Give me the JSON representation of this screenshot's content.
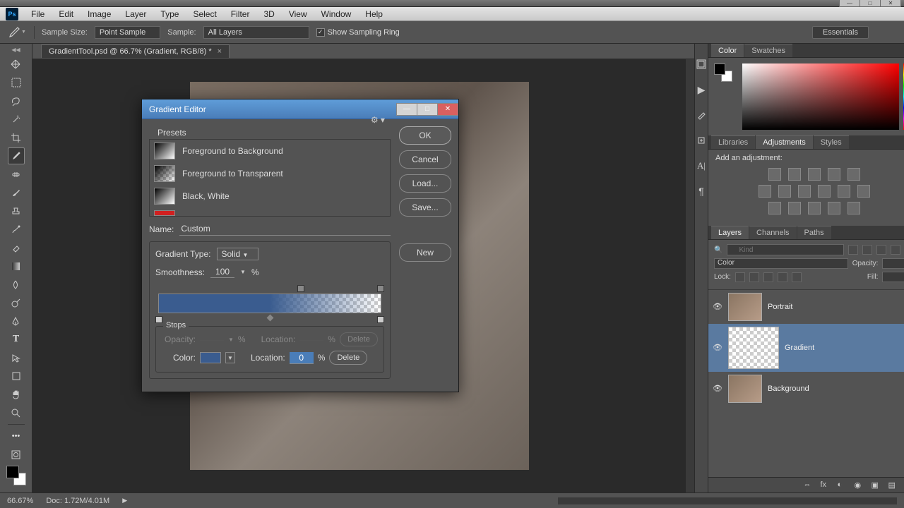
{
  "menu": [
    "File",
    "Edit",
    "Image",
    "Layer",
    "Type",
    "Select",
    "Filter",
    "3D",
    "View",
    "Window",
    "Help"
  ],
  "options_bar": {
    "sample_size_label": "Sample Size:",
    "sample_size_value": "Point Sample",
    "sample_label": "Sample:",
    "sample_value": "All Layers",
    "show_ring": "Show Sampling Ring",
    "workspace": "Essentials"
  },
  "doc_tab": "GradientTool.psd @ 66.7% (Gradient, RGB/8) *",
  "right": {
    "color_tabs": [
      "Color",
      "Swatches"
    ],
    "adj_tabs": [
      "Libraries",
      "Adjustments",
      "Styles"
    ],
    "adj_title": "Add an adjustment:",
    "layer_tabs": [
      "Layers",
      "Channels",
      "Paths"
    ],
    "kind_placeholder": "Kind",
    "blend_mode": "Color",
    "opacity_label": "Opacity:",
    "lock_label": "Lock:",
    "fill_label": "Fill:",
    "layers": [
      {
        "name": "Portrait",
        "sel": false,
        "trans": false,
        "big": false
      },
      {
        "name": "Gradient",
        "sel": true,
        "trans": true,
        "big": true
      },
      {
        "name": "Background",
        "sel": false,
        "trans": false,
        "big": false,
        "locked": true
      }
    ]
  },
  "status": {
    "zoom": "66.67%",
    "doc_info": "Doc: 1.72M/4.01M"
  },
  "dialog": {
    "title": "Gradient Editor",
    "presets_label": "Presets",
    "presets": [
      {
        "name": "Foreground to Background",
        "cls": "pt-fgbg"
      },
      {
        "name": "Foreground to Transparent",
        "cls": "pt-fgtr"
      },
      {
        "name": "Black, White",
        "cls": "pt-bw"
      }
    ],
    "buttons": {
      "ok": "OK",
      "cancel": "Cancel",
      "load": "Load...",
      "save": "Save...",
      "new": "New"
    },
    "name_label": "Name:",
    "name_value": "Custom",
    "grad_type_label": "Gradient Type:",
    "grad_type_value": "Solid",
    "smoothness_label": "Smoothness:",
    "smoothness_value": "100",
    "pct": "%",
    "stops_label": "Stops",
    "opacity_label": "Opacity:",
    "location_label": "Location:",
    "color_label": "Color:",
    "location_value": "0",
    "delete": "Delete"
  }
}
